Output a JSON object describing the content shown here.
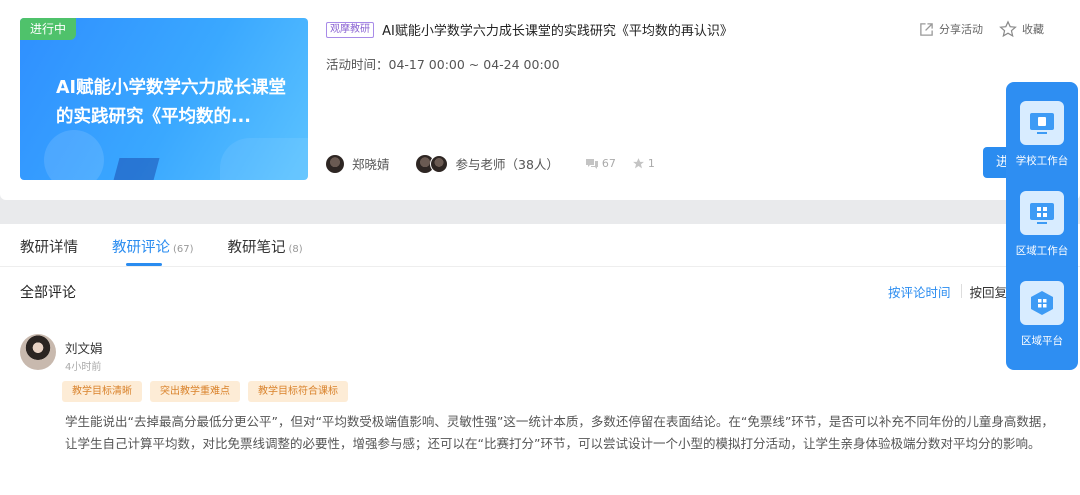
{
  "activity": {
    "status": "进行中",
    "cover_title": "AI赋能小学数学六力成长课堂的实践研究《平均数的...",
    "tag": "观摩教研",
    "title": "AI赋能小学数学六力成长课堂的实践研究《平均数的再认识》",
    "time": "活动时间：04-17 00:00 ~ 04-24 00:00",
    "host": "郑晓婧",
    "participants": "参与老师（38人）",
    "comments_count": "67",
    "likes_count": "1",
    "share_label": "分享活动",
    "favorite_label": "收藏",
    "enter_label": "进入"
  },
  "tabs": [
    {
      "label": "教研详情",
      "count": ""
    },
    {
      "label": "教研评论",
      "count": "(67)"
    },
    {
      "label": "教研笔记",
      "count": "(8)"
    }
  ],
  "comments_section": {
    "title": "全部评论",
    "sort_by_time": "按评论时间",
    "sort_by_reply": "按回复"
  },
  "comment": {
    "author": "刘文娟",
    "time": "4小时前",
    "tags": [
      "教学目标清晰",
      "突出教学重难点",
      "教学目标符合课标"
    ],
    "body": "学生能说出“去掉最高分最低分更公平”，但对“平均数受极端值影响、灵敏性强”这一统计本质，多数还停留在表面结论。在“免票线”环节，是否可以补充不同年份的儿童身高数据，让学生自己计算平均数，对比免票线调整的必要性，增强参与感；还可以在“比赛打分”环节，可以尝试设计一个小型的模拟打分活动，让学生亲身体验极端分数对平均分的影响。"
  },
  "float_panel": {
    "items": [
      {
        "label": "学校工作台",
        "icon": "school-workbench-icon"
      },
      {
        "label": "区域工作台",
        "icon": "region-workbench-icon"
      },
      {
        "label": "区域平台",
        "icon": "region-platform-icon"
      }
    ]
  },
  "colors": {
    "accent": "#2a8cf0",
    "status_green": "#4fc26b",
    "tag_purple": "#8a63d2",
    "comment_tag_bg": "#fdecd6",
    "comment_tag_text": "#d9822b"
  }
}
